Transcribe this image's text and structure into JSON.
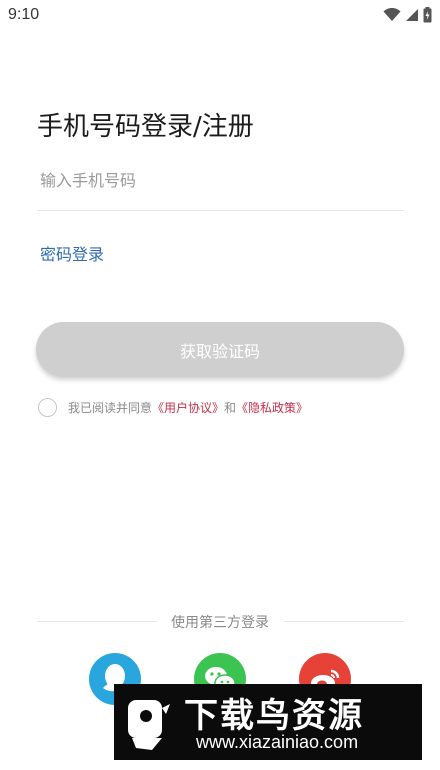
{
  "status_bar": {
    "time": "9:10"
  },
  "login": {
    "title": "手机号码登录/注册",
    "phone_placeholder": "输入手机号码",
    "password_login_link": "密码登录",
    "get_code_button": "获取验证码"
  },
  "agreement": {
    "prefix": "我已阅读并同意",
    "user_agreement": "《用户协议》",
    "joiner": "和",
    "privacy_policy": "《隐私政策》"
  },
  "third_party": {
    "label": "使用第三方登录",
    "providers": [
      {
        "icon": "qq-icon",
        "color": "#2aa6df"
      },
      {
        "icon": "wechat-icon",
        "color": "#3cc453"
      },
      {
        "icon": "weibo-icon",
        "color": "#e64238"
      }
    ]
  },
  "watermark": {
    "title": "下载鸟资源",
    "url": "www.xiazainiao.com"
  },
  "colors": {
    "link_blue": "#2f6db0",
    "link_red": "#c0314a",
    "button_disabled": "#cfcfcf"
  }
}
